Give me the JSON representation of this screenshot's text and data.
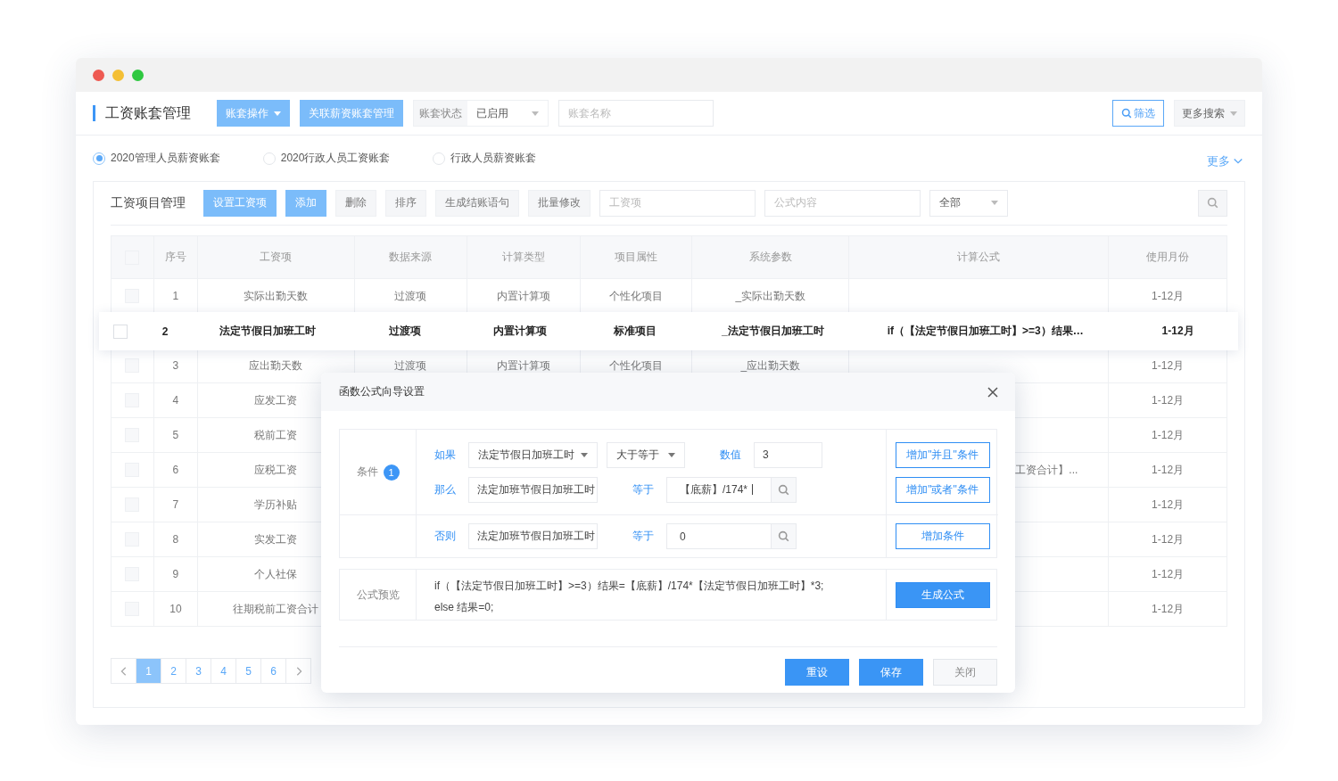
{
  "header": {
    "title": "工资账套管理",
    "buttons": [
      {
        "label": "账套操作",
        "kind": "dropdown"
      },
      {
        "label": "关联薪资账套管理",
        "kind": "plain"
      }
    ],
    "status_filter": {
      "label": "账套状态",
      "value": "已启用"
    },
    "name_field": {
      "placeholder": "账套名称"
    },
    "filter_button": "筛选",
    "more_search": "更多搜索"
  },
  "account_sets": [
    {
      "label": "2020管理人员薪资账套",
      "selected": true
    },
    {
      "label": "2020行政人员工资账套",
      "selected": false
    },
    {
      "label": "行政人员薪资账套",
      "selected": false
    }
  ],
  "more_link": "更多",
  "panel": {
    "title": "工资项目管理",
    "buttons": [
      {
        "label": "设置工资项",
        "kind": "primary"
      },
      {
        "label": "添加",
        "kind": "primary"
      },
      {
        "label": "删除",
        "kind": "default"
      },
      {
        "label": "排序",
        "kind": "default"
      },
      {
        "label": "生成结账语句",
        "kind": "default"
      },
      {
        "label": "批量修改",
        "kind": "default"
      }
    ],
    "item_field": {
      "placeholder": "工资项"
    },
    "formula_field": {
      "placeholder": "公式内容"
    },
    "scope_select": "全部"
  },
  "table": {
    "select_all_checked": false,
    "columns": [
      "序号",
      "工资项",
      "数据来源",
      "计算类型",
      "项目属性",
      "系统参数",
      "计算公式",
      "使用月份"
    ],
    "rows": [
      {
        "selected": false,
        "checked": false,
        "index": "1",
        "item": "实际出勤天数",
        "source": "过渡项",
        "calc_type": "内置计算项",
        "attribute": "个性化项目",
        "param": "_实际出勤天数",
        "months": "1-12月"
      },
      {
        "selected": true,
        "checked": false,
        "index": "2",
        "item": "法定节假日加班工时",
        "source": "过渡项",
        "calc_type": "内置计算项",
        "attribute": "标准项目",
        "param": "_法定节假日加班工时",
        "formula": "if（【法定节假日加班工时】>=3）结果…",
        "months": "1-12月"
      },
      {
        "selected": false,
        "checked": false,
        "index": "3",
        "item": "应出勤天数",
        "source": "过渡项",
        "calc_type": "内置计算项",
        "attribute": "个性化项目",
        "param": "_应出勤天数",
        "months": "1-12月"
      },
      {
        "selected": false,
        "checked": false,
        "index": "4",
        "item": "应发工资",
        "months": "1-12月"
      },
      {
        "selected": false,
        "checked": false,
        "index": "5",
        "item": "税前工资",
        "months": "1-12月"
      },
      {
        "selected": false,
        "checked": false,
        "index": "6",
        "item": "应税工资",
        "formula": "工资合计】...",
        "months": "1-12月"
      },
      {
        "selected": false,
        "checked": false,
        "index": "7",
        "item": "学历补贴",
        "months": "1-12月"
      },
      {
        "selected": false,
        "checked": false,
        "index": "8",
        "item": "实发工资",
        "months": "1-12月"
      },
      {
        "selected": false,
        "checked": false,
        "index": "9",
        "item": "个人社保",
        "months": "1-12月"
      },
      {
        "selected": false,
        "checked": false,
        "index": "10",
        "item": "往期税前工资合计",
        "months": "1-12月"
      }
    ]
  },
  "pagination": {
    "pages": [
      {
        "label": "1",
        "selected": true
      },
      {
        "label": "2",
        "selected": false
      },
      {
        "label": "3",
        "selected": false
      },
      {
        "label": "4",
        "selected": false
      },
      {
        "label": "5",
        "selected": false
      },
      {
        "label": "6",
        "selected": false
      }
    ]
  },
  "dialog": {
    "title": "函数公式向导设置",
    "condition": {
      "label": "条件",
      "badge": "1",
      "if": {
        "label": "如果",
        "field": "法定节假日加班工时",
        "operator": "大于等于",
        "value_label": "数值",
        "value": "3"
      },
      "then": {
        "label": "那么",
        "field": "法定加班节假日加班工时",
        "equals_label": "等于",
        "value": "【底薪】/174*",
        "focused": true
      },
      "else": {
        "label": "否则",
        "field": "法定加班节假日加班工时",
        "equals_label": "等于",
        "value": "0",
        "focused": false
      },
      "buttons": [
        "增加\"并且\"条件",
        "增加\"或者\"条件",
        "增加条件"
      ]
    },
    "preview": {
      "label": "公式预览",
      "lines": [
        "if（【法定节假日加班工时】>=3）结果=【底薪】/174*【法定节假日加班工时】*3;",
        "else 结果=0;"
      ],
      "button": "生成公式"
    },
    "footer": [
      {
        "label": "重设",
        "kind": "primary"
      },
      {
        "label": "保存",
        "kind": "primary"
      },
      {
        "label": "关闭",
        "kind": "default"
      }
    ]
  }
}
